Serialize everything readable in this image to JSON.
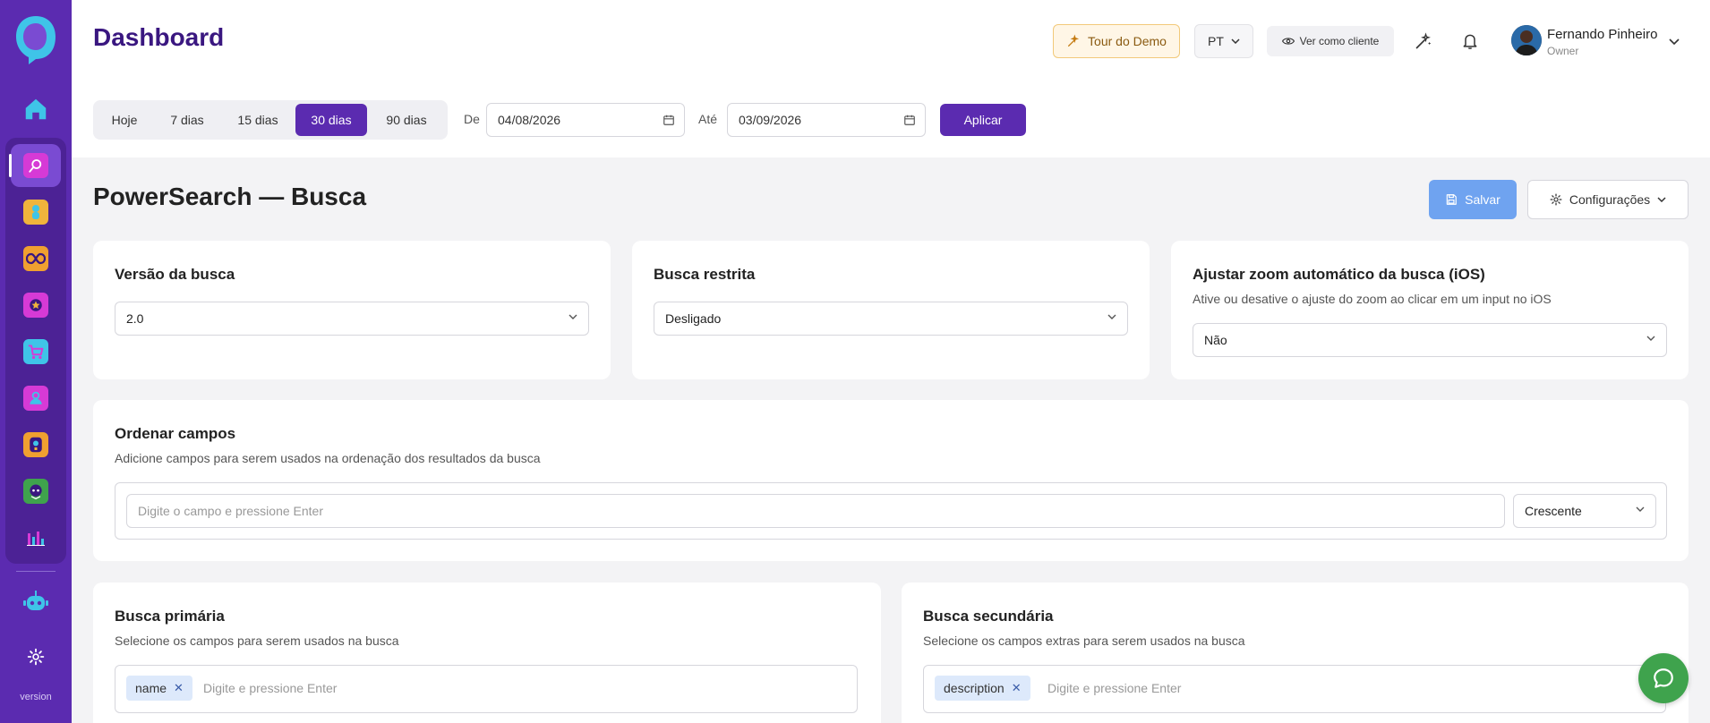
{
  "sidebar": {
    "items": [
      "home",
      "powersearch",
      "profile",
      "loop",
      "favorites",
      "cart",
      "users",
      "tracking",
      "assistant",
      "analytics",
      "bot",
      "settings"
    ],
    "version_label": "version"
  },
  "header": {
    "title": "Dashboard",
    "tour_label": "Tour do Demo",
    "language": "PT",
    "view_as_client": "Ver como cliente",
    "user": {
      "name": "Fernando Pinheiro",
      "role": "Owner"
    }
  },
  "date_filter": {
    "ranges": [
      {
        "label": "Hoje",
        "active": false
      },
      {
        "label": "7 dias",
        "active": false
      },
      {
        "label": "15 dias",
        "active": false
      },
      {
        "label": "30 dias",
        "active": true
      },
      {
        "label": "90 dias",
        "active": false
      }
    ],
    "from_label": "De",
    "from_value": "04/08/2026",
    "to_label": "Até",
    "to_value": "03/09/2026",
    "apply_label": "Aplicar"
  },
  "page": {
    "title": "PowerSearch — Busca",
    "save_label": "Salvar",
    "config_label": "Configurações"
  },
  "cards": {
    "version": {
      "title": "Versão da busca",
      "value": "2.0"
    },
    "restricted": {
      "title": "Busca restrita",
      "value": "Desligado"
    },
    "zoom": {
      "title": "Ajustar zoom automático da busca (iOS)",
      "subtitle": "Ative ou desative o ajuste do zoom ao clicar em um input no iOS",
      "value": "Não"
    },
    "sort": {
      "title": "Ordenar campos",
      "subtitle": "Adicione campos para serem usados na ordenação dos resultados da busca",
      "input_placeholder": "Digite o campo e pressione Enter",
      "order_value": "Crescente"
    },
    "primary": {
      "title": "Busca primária",
      "subtitle": "Selecione os campos para serem usados na busca",
      "tags": [
        "name"
      ],
      "placeholder": "Digite e pressione Enter"
    },
    "secondary": {
      "title": "Busca secundária",
      "subtitle": "Selecione os campos extras para serem usados na busca",
      "tags": [
        "description"
      ],
      "placeholder": "Digite e pressione Enter"
    }
  },
  "colors": {
    "sidebar": "#5b2bb0",
    "accent": "#5b2bb0",
    "save": "#6fa3f0",
    "chat": "#3fa34d"
  }
}
